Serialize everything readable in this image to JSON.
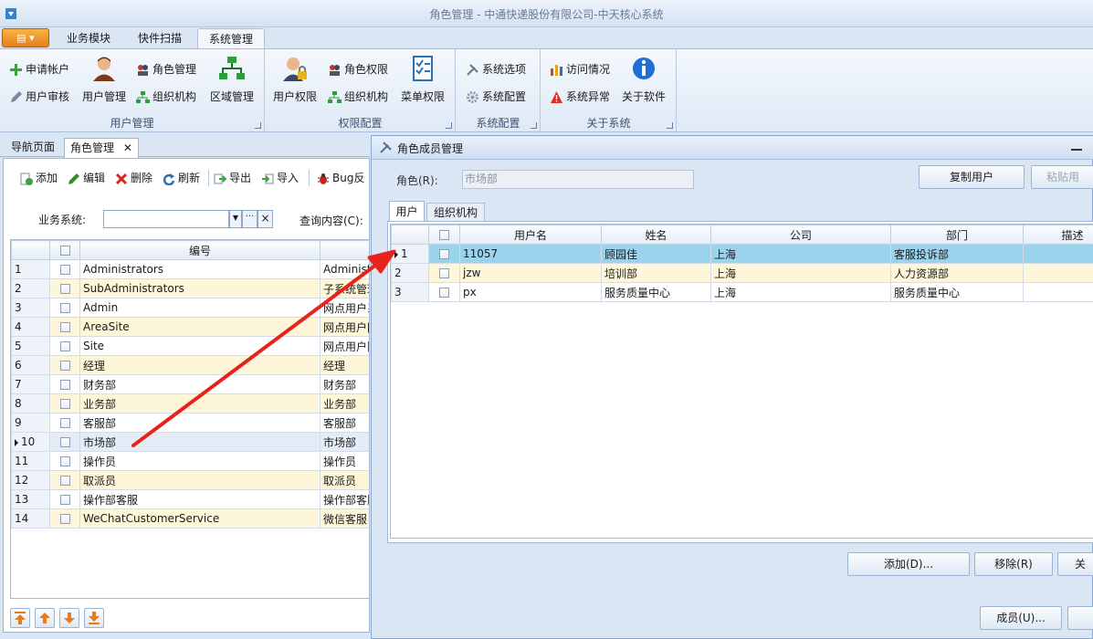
{
  "window": {
    "title": "角色管理 - 中通快递股份有限公司-中天核心系统"
  },
  "ribbon": {
    "tabs": [
      "业务模块",
      "快件扫描",
      "系统管理"
    ],
    "active_tab": "系统管理",
    "groups": [
      {
        "label": "用户管理",
        "small": [
          "申请帐户",
          "用户审核"
        ],
        "large": [
          "用户管理"
        ],
        "small2": [
          "角色管理",
          "组织机构"
        ],
        "large2": [
          "区域管理"
        ]
      },
      {
        "label": "权限配置",
        "large": [
          "用户权限"
        ],
        "small": [
          "角色权限",
          "组织机构"
        ],
        "large2": [
          "菜单权限"
        ]
      },
      {
        "label": "系统配置",
        "small": [
          "系统选项",
          "系统配置"
        ]
      },
      {
        "label": "关于系统",
        "small": [
          "访问情况",
          "系统异常"
        ],
        "large": [
          "关于软件"
        ]
      }
    ]
  },
  "doc_tabs": [
    "导航页面",
    "角色管理"
  ],
  "toolbar": {
    "add": "添加",
    "edit": "编辑",
    "delete": "删除",
    "refresh": "刷新",
    "export": "导出",
    "import": "导入",
    "bug": "Bug反"
  },
  "filter": {
    "system_label": "业务系统:",
    "system_value": "",
    "browse": "···",
    "clear": "×",
    "query_label": "查询内容(C):"
  },
  "roles_grid": {
    "columns": [
      "编号",
      ""
    ],
    "rows": [
      {
        "n": "1",
        "code": "Administrators",
        "name": "Administra"
      },
      {
        "n": "2",
        "code": "SubAdministrators",
        "name": "子系统管理"
      },
      {
        "n": "3",
        "code": "Admin",
        "name": "网点用户系"
      },
      {
        "n": "4",
        "code": "AreaSite",
        "name": "网点用户["
      },
      {
        "n": "5",
        "code": "Site",
        "name": "网点用户隔"
      },
      {
        "n": "6",
        "code": "经理",
        "name": "经理"
      },
      {
        "n": "7",
        "code": "财务部",
        "name": "财务部"
      },
      {
        "n": "8",
        "code": "业务部",
        "name": "业务部"
      },
      {
        "n": "9",
        "code": "客服部",
        "name": "客服部"
      },
      {
        "n": "10",
        "code": "市场部",
        "name": "市场部"
      },
      {
        "n": "11",
        "code": "操作员",
        "name": "操作员"
      },
      {
        "n": "12",
        "code": "取派员",
        "name": "取派员"
      },
      {
        "n": "13",
        "code": "操作部客服",
        "name": "操作部客服"
      },
      {
        "n": "14",
        "code": "WeChatCustomerService",
        "name": "微信客服"
      }
    ],
    "selected_row": "10"
  },
  "dialog": {
    "title": "角色成员管理",
    "role_label": "角色(R):",
    "role_value": "市场部",
    "copy_users": "复制用户",
    "paste_users": "粘贴用",
    "tabs": [
      "用户",
      "组织机构"
    ],
    "columns": [
      "用户名",
      "姓名",
      "公司",
      "部门",
      "描述"
    ],
    "rows": [
      {
        "n": "1",
        "user": "11057",
        "name": "顾园佳",
        "company": "上海",
        "dept": "客服投诉部",
        "desc": ""
      },
      {
        "n": "2",
        "user": "jzw",
        "name": "培训部",
        "company": "上海",
        "dept": "人力资源部",
        "desc": ""
      },
      {
        "n": "3",
        "user": "px",
        "name": "服务质量中心",
        "company": "上海",
        "dept": "服务质量中心",
        "desc": ""
      }
    ],
    "add": "添加(D)...",
    "remove": "移除(R)",
    "close": "关"
  },
  "bottom": {
    "members": "成员(U)..."
  },
  "colors": {
    "accent": "#e3801c",
    "selected_row": "#9bd2ec",
    "alt_row": "#fdf6d8",
    "arrow": "#e8231b"
  }
}
